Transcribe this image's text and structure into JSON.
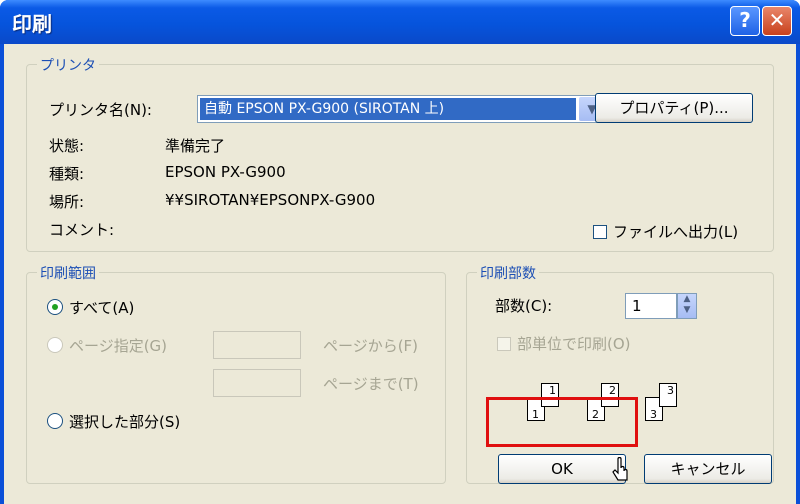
{
  "titlebar": {
    "title": "印刷",
    "help_glyph": "?",
    "close_glyph": "✕"
  },
  "printer": {
    "legend": "プリンタ",
    "name_label": "プリンタ名(N):",
    "name_value": "自動 EPSON PX-G900 (SIROTAN 上)",
    "properties_button": "プロパティ(P)...",
    "status_label": "状態:",
    "status_value": "準備完了",
    "type_label": "種類:",
    "type_value": "EPSON PX-G900",
    "location_label": "場所:",
    "location_value": "¥¥SIROTAN¥EPSONPX-G900",
    "comment_label": "コメント:",
    "print_to_file": "ファイルへ出力(L)"
  },
  "range": {
    "legend": "印刷範囲",
    "all": "すべて(A)",
    "pages": "ページ指定(G)",
    "from": "ページから(F)",
    "to": "ページまで(T)",
    "selection": "選択した部分(S)"
  },
  "copies": {
    "legend": "印刷部数",
    "count_label": "部数(C):",
    "count_value": "1",
    "collate": "部単位で印刷(O)",
    "collate_pages": [
      "1",
      "1",
      "2",
      "2",
      "3",
      "3"
    ]
  },
  "buttons": {
    "ok": "OK",
    "cancel": "キャンセル"
  },
  "colors": {
    "titlebar": "#0a4fd8",
    "legend_text": "#1c4fb5",
    "highlight": "#e01010",
    "selection_bg": "#316ac5"
  }
}
